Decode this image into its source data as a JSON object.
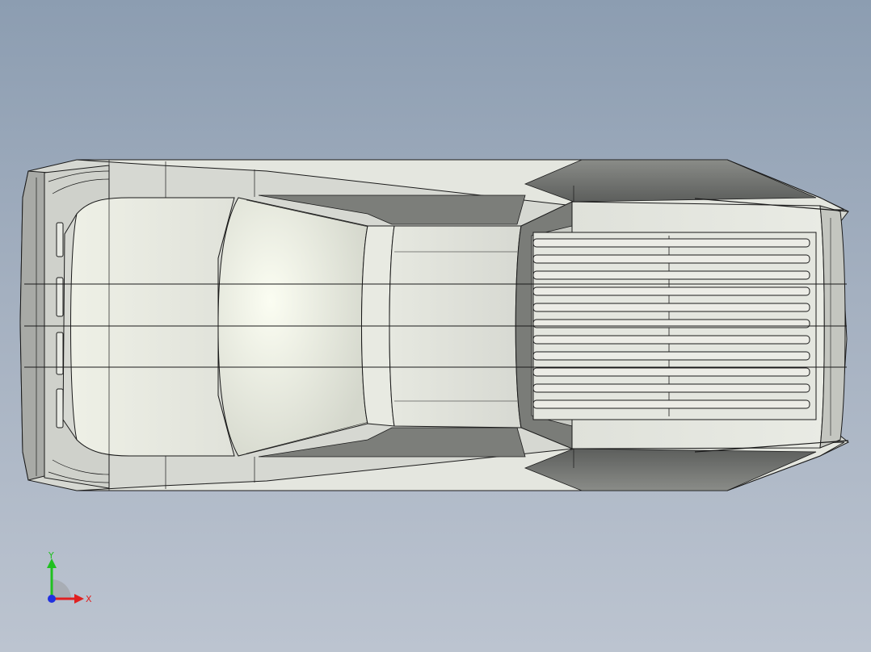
{
  "viewport": {
    "background_top": "#8c9db1",
    "background_bottom": "#bcc4d0"
  },
  "model": {
    "body_color": "#d8dad4",
    "edge_color": "#1a1a1a",
    "shadow_color": "#6a6c6a",
    "highlight_color": "#f4f6ee"
  },
  "triad": {
    "x_label": "X",
    "y_label": "Y",
    "x_color": "#e02020",
    "y_color": "#20c020",
    "origin_color": "#2030e0"
  }
}
